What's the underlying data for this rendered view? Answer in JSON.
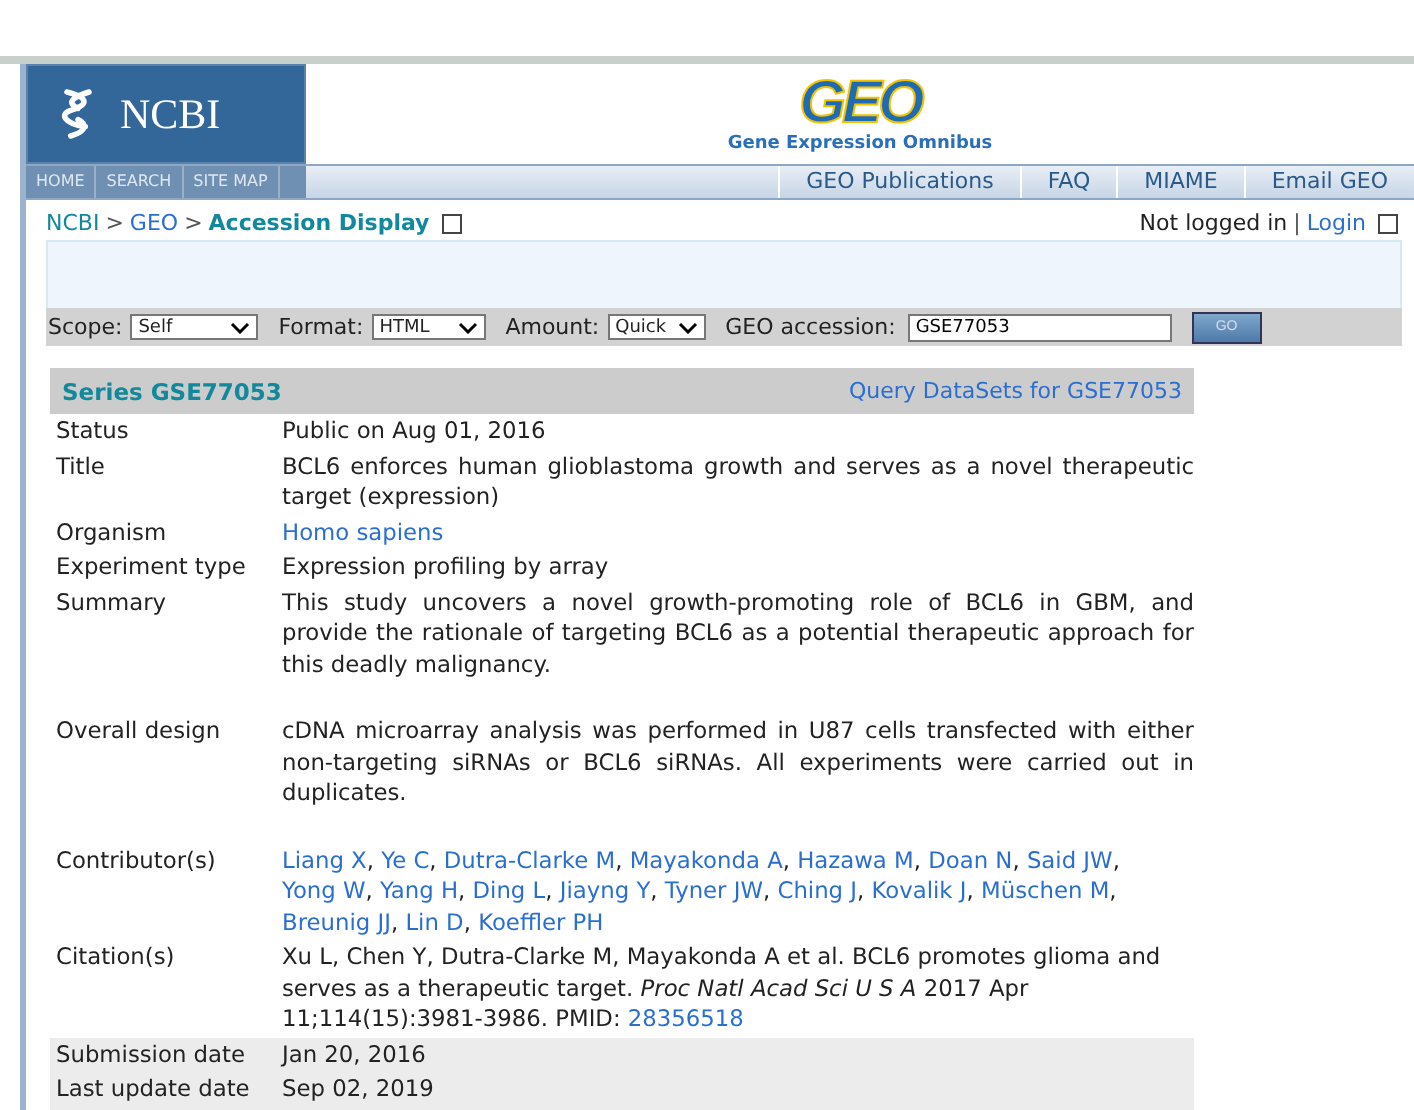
{
  "header": {
    "ncbi_logo": "NCBI",
    "geo_logo": "GEO",
    "geo_subtitle": "Gene Expression Omnibus"
  },
  "nav": {
    "left": [
      "HOME",
      "SEARCH",
      "SITE MAP"
    ],
    "right": [
      "GEO Publications",
      "FAQ",
      "MIAME",
      "Email GEO"
    ]
  },
  "breadcrumb": {
    "items": [
      {
        "label": "NCBI",
        "kind": "link"
      },
      {
        "label": ">",
        "kind": "sep"
      },
      {
        "label": "GEO",
        "kind": "link"
      },
      {
        "label": ">",
        "kind": "sep"
      },
      {
        "label": "Accession Display",
        "kind": "current"
      }
    ],
    "status": "Not logged in",
    "separator": "|",
    "login": "Login"
  },
  "query_bar": {
    "scope_label": "Scope:",
    "scope": "Self",
    "format_label": "Format:",
    "format": "HTML",
    "amount_label": "Amount:",
    "amount": "Quick",
    "accession_label": "GEO accession:",
    "accession": "GSE77053",
    "go": "GO"
  },
  "series": {
    "title": "Series GSE77053",
    "query_link": "Query DataSets for GSE77053"
  },
  "rows": [
    {
      "label": "Status",
      "kind": "text",
      "shaded": false,
      "value": "Public on Aug 01, 2016"
    },
    {
      "label": "Title",
      "kind": "text",
      "shaded": false,
      "value": "BCL6 enforces human glioblastoma growth and serves as a novel therapeutic target (expression)"
    },
    {
      "label": "Organism",
      "kind": "link",
      "shaded": false,
      "value": "Homo sapiens"
    },
    {
      "label": "Experiment type",
      "kind": "text",
      "shaded": false,
      "value": "Expression profiling by array"
    },
    {
      "label": "Summary",
      "kind": "paragraph",
      "shaded": false,
      "value": "This study uncovers a novel growth-promoting role of BCL6 in GBM, and provide the rationale of targeting BCL6 as a potential therapeutic approach for this deadly malignancy."
    },
    {
      "label": "Overall design",
      "kind": "paragraph",
      "shaded": false,
      "value": "cDNA microarray analysis was performed in U87 cells transfected with either non-targeting siRNAs or BCL6 siRNAs. All experiments were carried out in duplicates."
    },
    {
      "label": "Contributor(s)",
      "kind": "links",
      "shaded": false,
      "separator": ",",
      "links": [
        "Liang X",
        "Ye C",
        "Dutra-Clarke M",
        "Mayakonda A",
        "Hazawa M",
        "Doan N",
        "Said JW",
        "Yong W",
        "Yang H",
        "Ding L",
        "Jiayng Y",
        "Tyner JW",
        "Ching J",
        "Kovalik J",
        "Müschen M",
        "Breunig JJ",
        "Lin D",
        "Koeffler PH"
      ]
    },
    {
      "label": "Citation(s)",
      "kind": "citation",
      "shaded": false,
      "value": "Xu L, Chen Y, Dutra-Clarke M, Mayakonda A et al. BCL6 promotes glioma and serves as a therapeutic target. *Proc Natl Acad Sci U S A* 2017 Apr 11;114(15):3981-3986. PMID: ",
      "link": "28356518"
    },
    {
      "label": "Submission date",
      "kind": "text",
      "shaded": true,
      "value": "Jan 20, 2016"
    },
    {
      "label": "Last update date",
      "kind": "text",
      "shaded": true,
      "value": "Sep 02, 2019"
    }
  ]
}
